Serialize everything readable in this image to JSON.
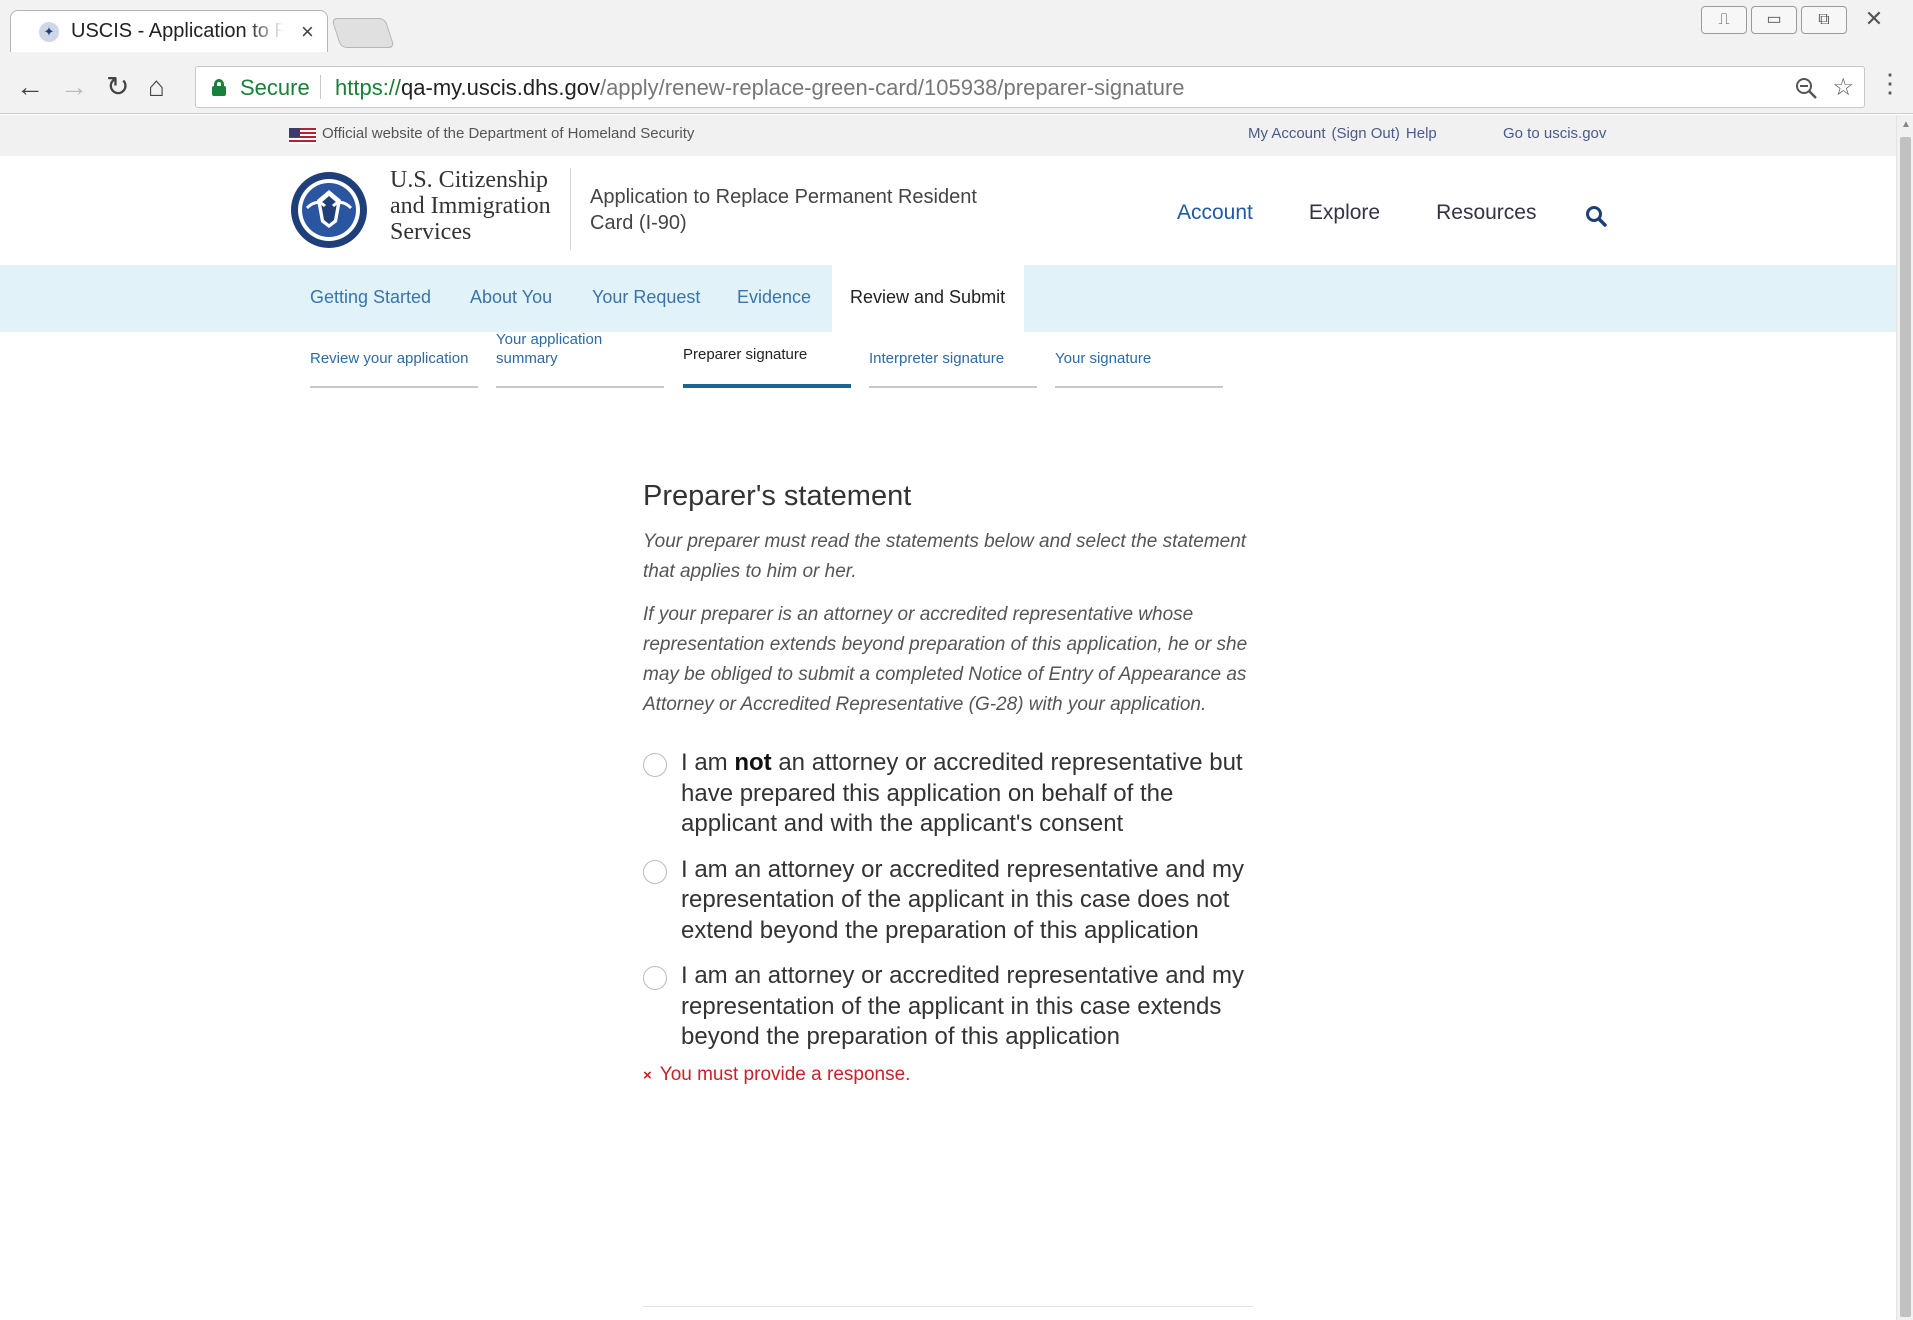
{
  "browser": {
    "tab_title": "USCIS - Application to Re",
    "tab_close": "×",
    "secure_label": "Secure",
    "url_scheme": "https://",
    "url_host": "qa-my.uscis.dhs.gov",
    "url_path": "/apply/renew-replace-green-card/105938/preparer-signature",
    "window_controls": [
      "⎍",
      "▭",
      "⧉",
      "✕"
    ],
    "zoom_icon": "zoom-out-icon",
    "bookmark_icon": "star-icon"
  },
  "gov_banner": {
    "text": "Official website of the Department of Homeland Security",
    "my_account": "My Account",
    "sign_out": "(Sign Out)",
    "help": "Help",
    "go_uscis": "Go to uscis.gov"
  },
  "header": {
    "agency_line1": "U.S. Citizenship",
    "agency_line2": "and Immigration",
    "agency_line3": "Services",
    "app_title": "Application to Replace Permanent Resident Card (I-90)",
    "nav": [
      "Account",
      "Explore",
      "Resources"
    ]
  },
  "steps": {
    "items": [
      "Getting Started",
      "About You",
      "Your Request",
      "Evidence",
      "Review and Submit"
    ],
    "active_index": 4
  },
  "substeps": {
    "items": [
      "Review your application",
      "Your application summary",
      "Preparer signature",
      "Interpreter signature",
      "Your signature"
    ],
    "active_index": 2
  },
  "main": {
    "heading": "Preparer's statement",
    "intro": "Your preparer must read the statements below and select the statement that applies to him or her.",
    "intro2": "If your preparer is an attorney or accredited representative whose representation extends beyond preparation of this application, he or she may be obliged to submit a completed Notice of Entry of Appearance as Attorney or Accredited Representative (G-28) with your application.",
    "option1_pre": "I am ",
    "option1_bold": "not",
    "option1_post": " an attorney or accredited representative but have prepared this application on behalf of the applicant and with the applicant's consent",
    "option2": "I am an attorney or accredited representative and my representation of the applicant in this case does not extend beyond the preparation of this application",
    "option3": "I am an attorney or accredited representative and my representation of the applicant in this case extends beyond the preparation of this application",
    "error_icon": "×",
    "error": "You must provide a response."
  },
  "colors": {
    "link_blue": "#3b74a8",
    "error_red": "#cd2026",
    "step_bar_bg": "#e1f3f8",
    "active_underline": "#1a6496",
    "secure_green": "#188038"
  }
}
